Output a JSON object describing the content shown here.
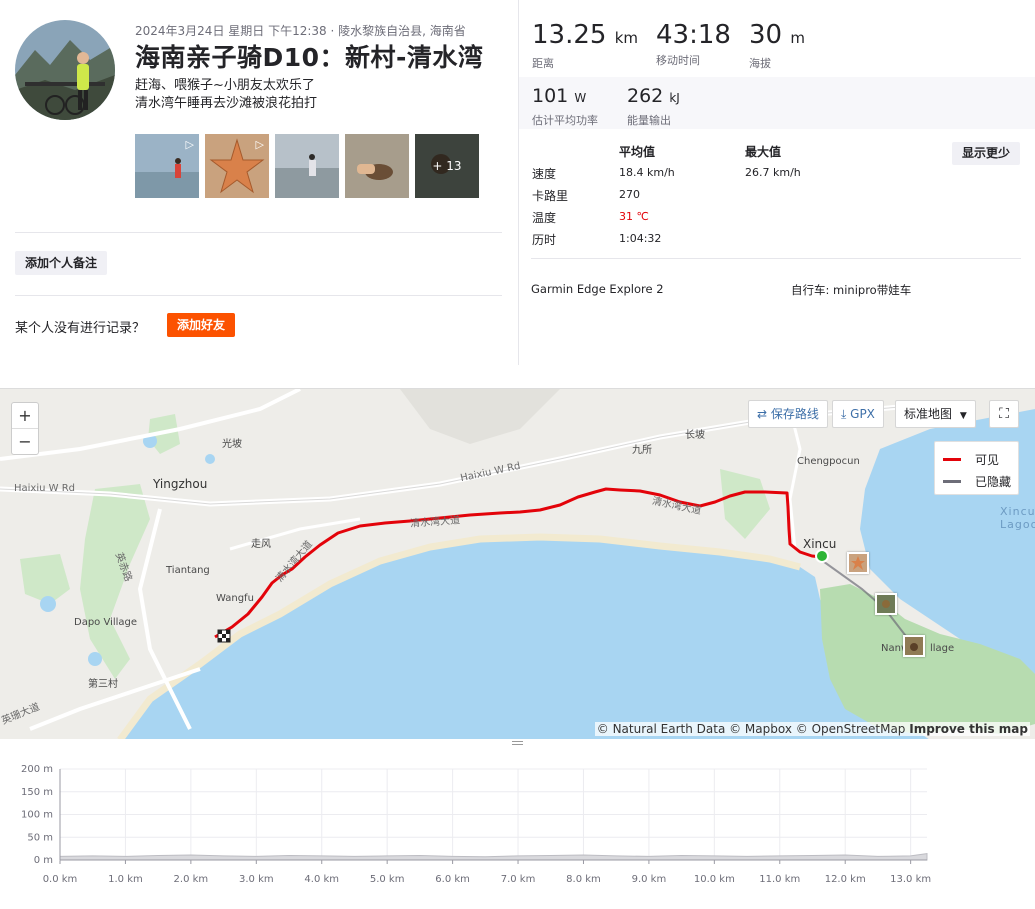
{
  "activity": {
    "meta": "2024年3月24日 星期日 下午12:38 · 陵水黎族自治县, 海南省",
    "title": "海南亲子骑D10：新村-清水湾",
    "description_lines": [
      "赶海、喂猴子~小朋友太欢乐了",
      "清水湾午睡再去沙滩被浪花拍打"
    ],
    "more_photos": "+ 13",
    "add_note_label": "添加个人备注",
    "no_record_text": "某个人没有进行记录？",
    "add_friend_label": "添加好友"
  },
  "stats": {
    "distance": {
      "value": "13.25",
      "unit": "km",
      "label": "距离"
    },
    "moving_time": {
      "value": "43:18",
      "unit": "",
      "label": "移动时间"
    },
    "elevation": {
      "value": "30",
      "unit": "m",
      "label": "海拔"
    },
    "power": {
      "value": "101",
      "unit": "W",
      "label": "估计平均功率"
    },
    "energy": {
      "value": "262",
      "unit": "kJ",
      "label": "能量输出"
    }
  },
  "details": {
    "col_avg": "平均值",
    "col_max": "最大值",
    "show_less": "显示更少",
    "rows": [
      {
        "label": "速度",
        "avg": "18.4 km/h",
        "max": "26.7 km/h"
      },
      {
        "label": "卡路里",
        "avg": "270",
        "max": ""
      },
      {
        "label": "温度",
        "avg": "31 ℃",
        "max": ""
      },
      {
        "label": "历时",
        "avg": "1:04:32",
        "max": ""
      }
    ],
    "device": "Garmin Edge Explore 2",
    "bike": "自行车: minipro带娃车"
  },
  "map": {
    "save_route": "保存路线",
    "gpx": "GPX",
    "map_type": "标准地图",
    "legend_visible": "可见",
    "legend_hidden": "已隐藏",
    "attribution_prefix": "© Natural Earth Data © Mapbox © OpenStreetMap ",
    "attribution_link": "Improve this map",
    "labels": {
      "guangpo": "光坡",
      "haixiu_w_left": "Haixiu W Rd",
      "yingzhou": "Yingzhou",
      "haixiu_w_mid": "Haixiu W Rd",
      "jiusuo": "九所",
      "changpo": "长坡",
      "chengpocun": "Chengpocun",
      "xincun_lagoon": "Xincun Lagoon",
      "zoufeng": "走风",
      "tiantang": "Tiantang",
      "wangfu": "Wangfu",
      "dapo": "Dapo Village",
      "sancun": "第三村",
      "yingchi": "英赤路",
      "qingshui_left": "清水湾大道",
      "qingshui_mid": "清水湾大道",
      "qingshui_right": "清水湾大道",
      "xincun": "Xincu",
      "nanwan": "Nanw",
      "nanwan_tail": "llage",
      "yingzhen": "英珊大道"
    },
    "colors": {
      "route": "#e3030a",
      "hidden": "#6d6d78",
      "sea": "#a8d5f2",
      "land": "#eeede9",
      "forest": "#b7dcb0"
    }
  },
  "elevation_chart": {
    "y_ticks": [
      "200 m",
      "150 m",
      "100 m",
      "50 m",
      "0 m"
    ],
    "y_values": [
      200,
      150,
      100,
      50,
      0
    ],
    "x_ticks": [
      "0.0 km",
      "1.0 km",
      "2.0 km",
      "3.0 km",
      "4.0 km",
      "5.0 km",
      "6.0 km",
      "7.0 km",
      "8.0 km",
      "9.0 km",
      "10.0 km",
      "11.0 km",
      "12.0 km",
      "13.0 km"
    ],
    "distance_km": [
      0,
      0.5,
      1,
      1.5,
      2,
      2.5,
      3,
      3.5,
      4,
      4.5,
      5,
      5.5,
      6,
      6.5,
      7,
      7.5,
      8,
      8.5,
      9,
      9.5,
      10,
      10.5,
      11,
      11.5,
      12,
      12.5,
      13,
      13.25
    ],
    "elevation_m": [
      8,
      9,
      8,
      10,
      11,
      9,
      8,
      10,
      9,
      8,
      9,
      10,
      8,
      7,
      9,
      10,
      11,
      9,
      8,
      10,
      9,
      8,
      9,
      10,
      11,
      8,
      9,
      14
    ]
  }
}
